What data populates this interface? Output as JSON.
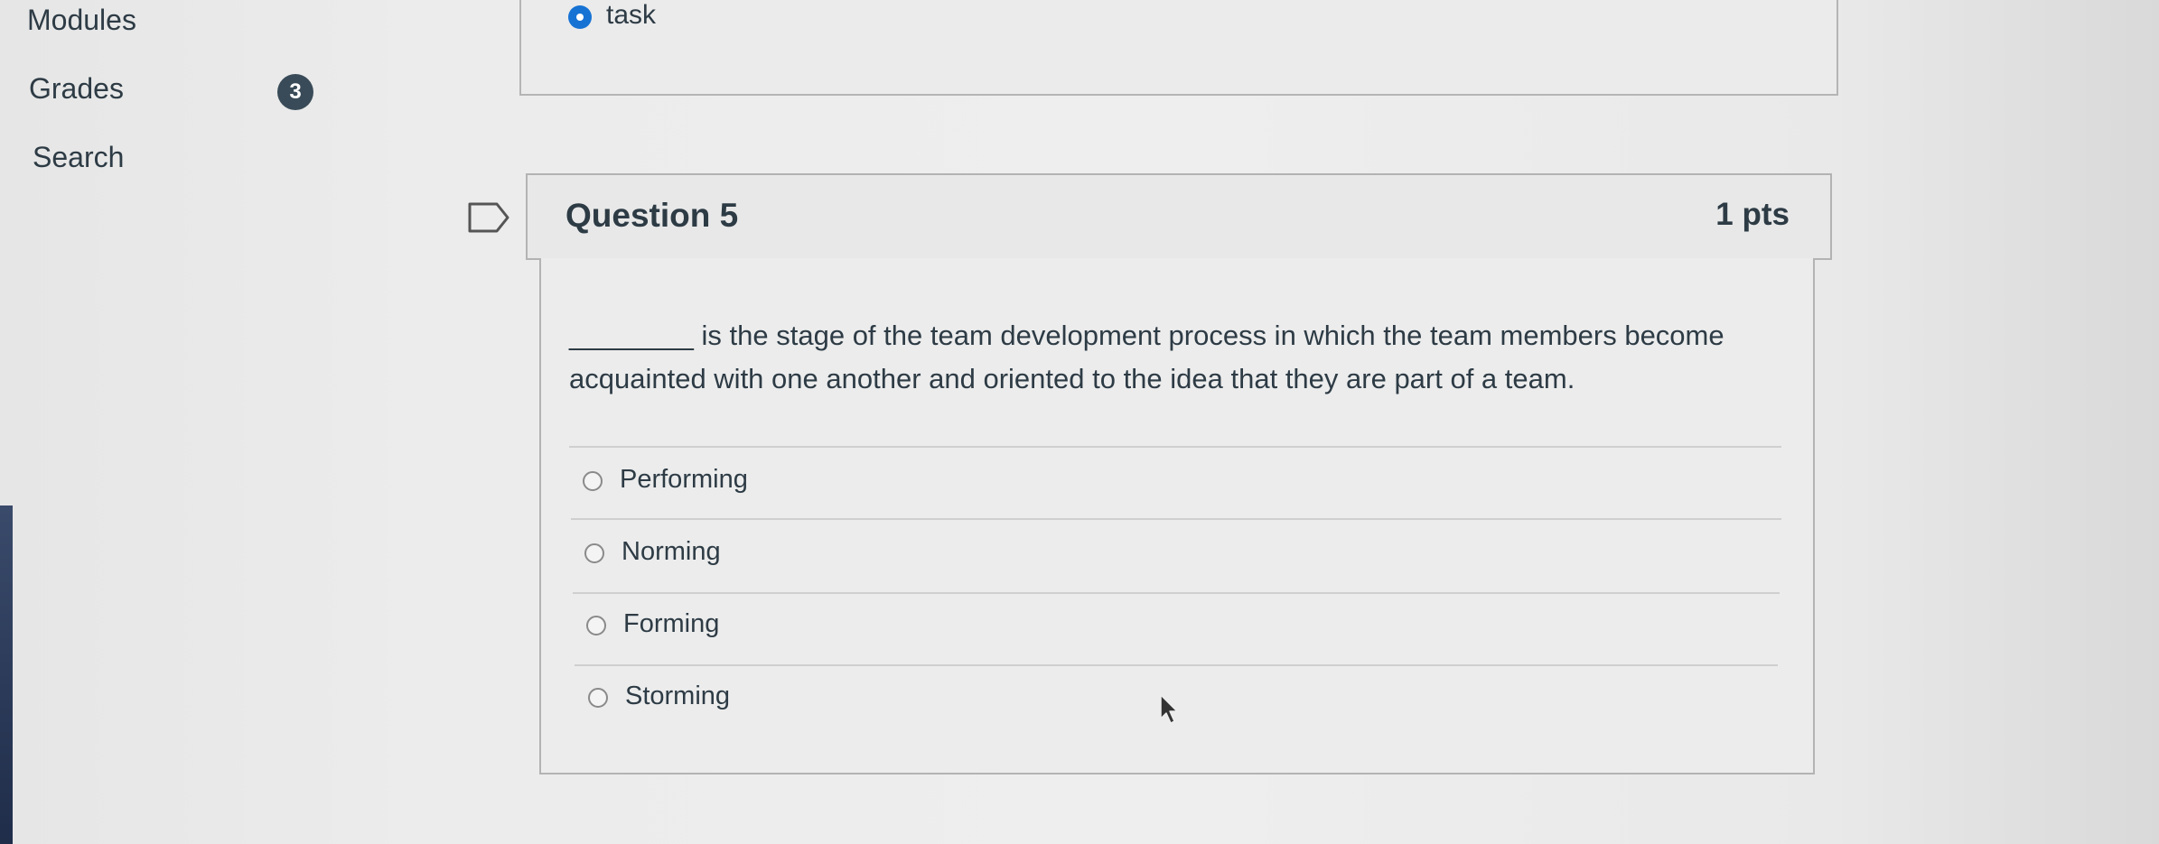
{
  "sidebar": {
    "items": [
      {
        "label": "Modules"
      },
      {
        "label": "Grades",
        "badge": "3"
      },
      {
        "label": "Search"
      }
    ]
  },
  "previous_question": {
    "selected_answer": "task"
  },
  "question": {
    "title": "Question 5",
    "points": "1 pts",
    "text": "________ is the stage of the team development process in which the team members become acquainted with one another and oriented to the idea that they are part of a team.",
    "answers": [
      {
        "label": "Performing",
        "selected": false
      },
      {
        "label": "Norming",
        "selected": false
      },
      {
        "label": "Forming",
        "selected": false
      },
      {
        "label": "Storming",
        "selected": false
      }
    ]
  },
  "colors": {
    "accent": "#1673d4",
    "badge_bg": "#394b58",
    "text": "#2d3b45"
  },
  "icons": [
    "flag-icon",
    "mouse-cursor-icon",
    "radio-button-icon"
  ]
}
